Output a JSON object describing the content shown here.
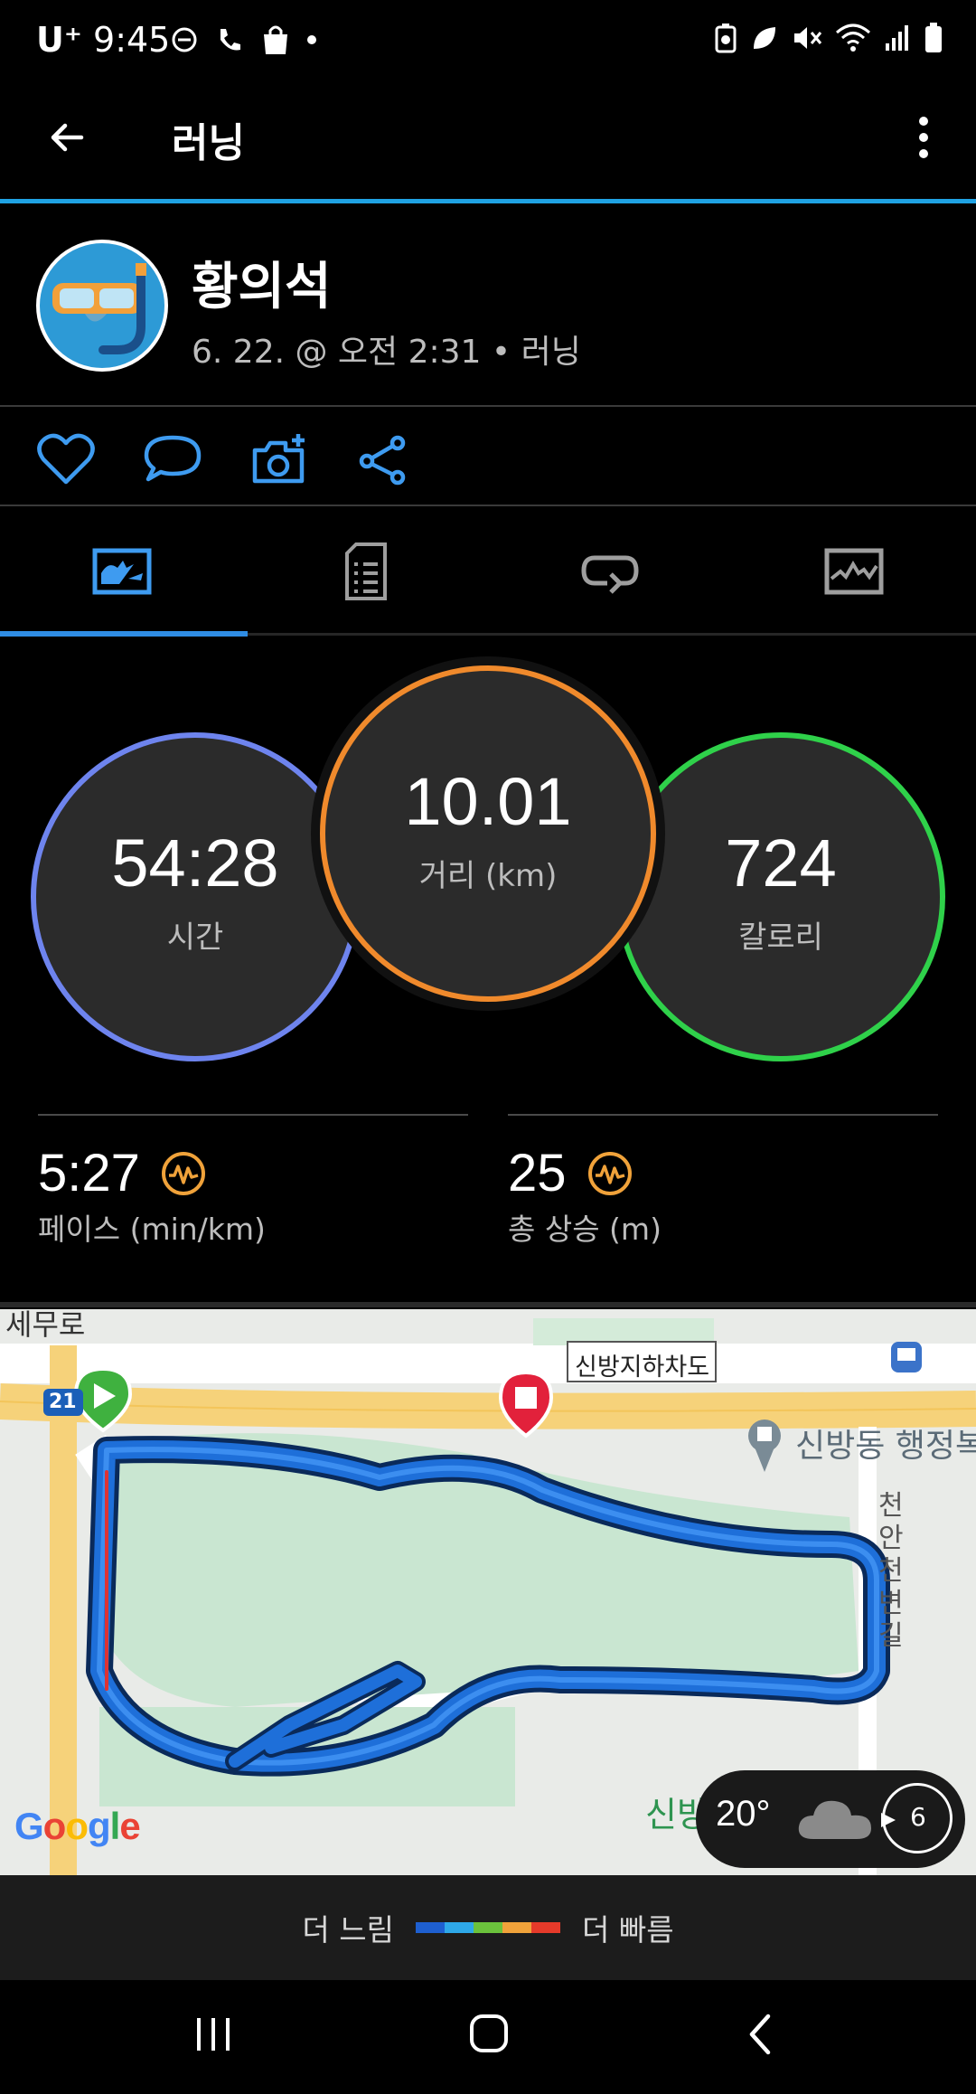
{
  "status_bar": {
    "carrier": "U⁺",
    "time": "9:45",
    "icons_left": [
      "dnd-icon",
      "wifi-call-icon",
      "shopping-bag-icon",
      "dot-icon"
    ],
    "icons_right": [
      "battery-saver-icon",
      "eco-icon",
      "mute-icon",
      "wifi-icon",
      "signal-icon",
      "battery-icon"
    ]
  },
  "app_bar": {
    "title": "러닝",
    "back_icon": "arrow-left-icon",
    "menu_icon": "more-vert-icon"
  },
  "profile": {
    "name": "황의석",
    "meta": "6. 22. @ 오전 2:31 • 러닝"
  },
  "actions": [
    "heart-icon",
    "comment-icon",
    "camera-add-icon",
    "share-icon"
  ],
  "tabs": [
    "overview-icon",
    "details-icon",
    "laps-icon",
    "charts-icon"
  ],
  "summary": {
    "time": {
      "value": "54:28",
      "label": "시간"
    },
    "distance": {
      "value": "10.01",
      "label": "거리 (km)"
    },
    "calories": {
      "value": "724",
      "label": "칼로리"
    }
  },
  "stats": [
    {
      "value": "5:27",
      "label": "페이스 (min/km)",
      "icon": "chart-wave-icon"
    },
    {
      "value": "25",
      "label": "총 상승 (m)",
      "icon": "chart-wave-icon"
    }
  ],
  "map": {
    "labels": {
      "road_top_left": "세무로",
      "underpass": "신방지하차도",
      "office": "신방동 행정복",
      "stream": "천안천변길",
      "bottom": "신방",
      "route_num": "21"
    },
    "google": "Google"
  },
  "weather": {
    "temp": "20°",
    "wind": "6"
  },
  "legend": {
    "slow": "더 느림",
    "fast": "더 빠름"
  },
  "colors": {
    "accent": "#1fa2e3",
    "time_ring": "#6a7ff0",
    "distance_ring": "#f08a2c",
    "calorie_ring": "#2fd14a",
    "route": "#1e6fd9"
  }
}
